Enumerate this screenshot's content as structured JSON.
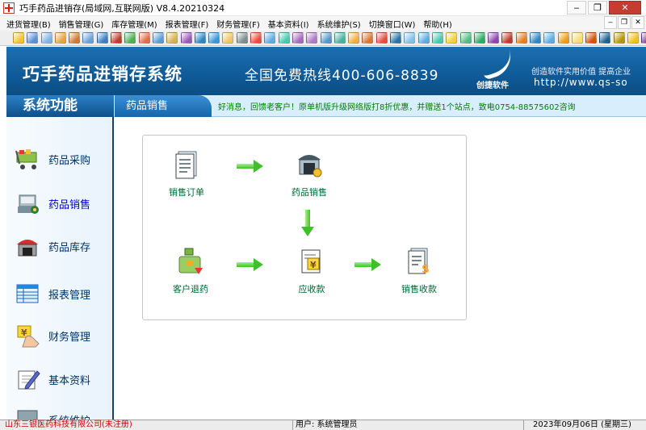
{
  "window": {
    "title": "巧手药品进销存(局域网,互联网版) V8.4.20210324",
    "controls": [
      "minimize",
      "restore",
      "close"
    ]
  },
  "menu": [
    "进货管理(B)",
    "销售管理(G)",
    "库存管理(M)",
    "报表管理(F)",
    "财务管理(F)",
    "基本资料(I)",
    "系统维护(S)",
    "切换窗口(W)",
    "帮助(H)"
  ],
  "mdi_controls": [
    "minimize",
    "restore",
    "close"
  ],
  "toolbar_icons": [
    {
      "name": "gear",
      "color": "#f2c230"
    },
    {
      "name": "user",
      "color": "#5b8fd6"
    },
    {
      "name": "doc",
      "color": "#7fb2e5"
    },
    {
      "name": "cube",
      "color": "#e8a33c"
    },
    {
      "name": "box",
      "color": "#d27a2c"
    },
    {
      "name": "grid",
      "color": "#6aa0d8"
    },
    {
      "name": "book",
      "color": "#3b7dc4"
    },
    {
      "name": "brush",
      "color": "#c0392b"
    },
    {
      "name": "coin",
      "color": "#4caf50"
    },
    {
      "name": "cart",
      "color": "#e26b4b"
    },
    {
      "name": "table",
      "color": "#5a9bd5"
    },
    {
      "name": "note",
      "color": "#d9b24c"
    },
    {
      "name": "stack",
      "color": "#9b59b6"
    },
    {
      "name": "bars",
      "color": "#2e86c1"
    },
    {
      "name": "list",
      "color": "#3498db"
    },
    {
      "name": "search",
      "color": "#f0c75e"
    },
    {
      "name": "calc",
      "color": "#7f8c8d"
    },
    {
      "name": "home",
      "color": "#e74c3c"
    },
    {
      "name": "table2",
      "color": "#5dade2"
    },
    {
      "name": "table3",
      "color": "#48c9b0"
    },
    {
      "name": "pen",
      "color": "#a569bd"
    },
    {
      "name": "box2",
      "color": "#af7ac5"
    },
    {
      "name": "lab",
      "color": "#5499c7"
    },
    {
      "name": "tags",
      "color": "#45b39d"
    },
    {
      "name": "mark",
      "color": "#f5b041"
    },
    {
      "name": "chart",
      "color": "#dc7633"
    },
    {
      "name": "pie",
      "color": "#e74c3c"
    },
    {
      "name": "grid2",
      "color": "#2874a6"
    },
    {
      "name": "sheet",
      "color": "#85c1e9"
    },
    {
      "name": "sheet2",
      "color": "#5dade2"
    },
    {
      "name": "sheet3",
      "color": "#48c9b0"
    },
    {
      "name": "stamp",
      "color": "#f4d03f"
    },
    {
      "name": "gem",
      "color": "#52be80"
    },
    {
      "name": "dollar",
      "color": "#27ae60"
    },
    {
      "name": "wrench",
      "color": "#8e44ad"
    },
    {
      "name": "flag",
      "color": "#c0392b"
    },
    {
      "name": "puzzle",
      "color": "#e67e22"
    },
    {
      "name": "eye",
      "color": "#2e86c1"
    },
    {
      "name": "rain",
      "color": "#5dade2"
    },
    {
      "name": "bag",
      "color": "#f39c12"
    },
    {
      "name": "smile",
      "color": "#f7dc6f"
    },
    {
      "name": "person",
      "color": "#d35400"
    },
    {
      "name": "grid3",
      "color": "#1f618d"
    },
    {
      "name": "key",
      "color": "#b7950b"
    },
    {
      "name": "medal",
      "color": "#f1c40f"
    },
    {
      "name": "tool",
      "color": "#7d3c98"
    }
  ],
  "banner": {
    "title": "巧手药品进销存系统",
    "hotline": "全国免费热线400-606-8839",
    "logo_text": "创捷软件",
    "slogan": "创造软件实用价值   提高企业",
    "url": "http://www.qs-so"
  },
  "header": {
    "system_title": "系统功能",
    "section_tab": "药品销售",
    "notice": "好消息，回馈老客户！原单机版升级网络版打8折优惠，并赠送1个站点，致电0754-88575602咨询"
  },
  "sidebar": {
    "items": [
      {
        "label": "药品采购",
        "icon": "cart-icon",
        "active": false
      },
      {
        "label": "药品销售",
        "icon": "sales-icon",
        "active": true
      },
      {
        "label": "药品库存",
        "icon": "warehouse-icon",
        "active": false
      },
      {
        "label": "报表管理",
        "icon": "table-icon",
        "active": false
      },
      {
        "label": "财务管理",
        "icon": "money-hand-icon",
        "active": false
      },
      {
        "label": "基本资料",
        "icon": "edit-icon",
        "active": false
      },
      {
        "label": "系统维护",
        "icon": "settings-icon",
        "active": false
      }
    ]
  },
  "flow": {
    "nodes": {
      "sales_order": "销售订单",
      "drug_sales": "药品销售",
      "customer_return": "客户退药",
      "receivable": "应收款",
      "sales_receipt": "销售收款"
    }
  },
  "status": {
    "company": "山东三银医药科技有限公司(未注册)",
    "user": "用户: 系统管理员",
    "date": "2023年09月06日 (星期三)"
  }
}
